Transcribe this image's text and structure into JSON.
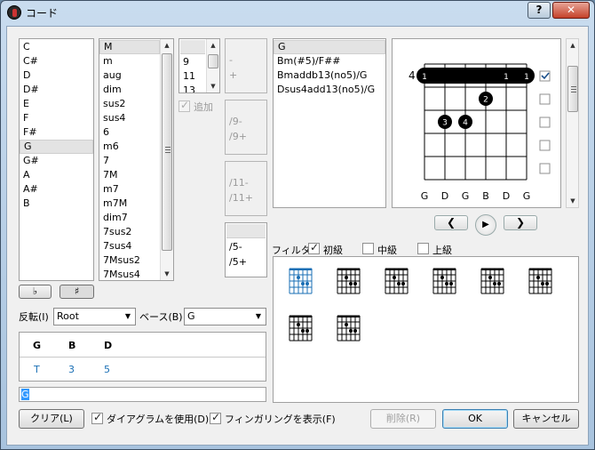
{
  "window": {
    "title": "コード",
    "help": "?",
    "close": "✕"
  },
  "root_list": [
    "C",
    "C#",
    "D",
    "D#",
    "E",
    "F",
    "F#",
    "G",
    "G#",
    "A",
    "A#",
    "B"
  ],
  "root_selected": 7,
  "quality_list": [
    "M",
    "m",
    "aug",
    "dim",
    "sus2",
    "sus4",
    "6",
    "m6",
    "7",
    "7M",
    "m7",
    "m7M",
    "dim7",
    "7sus2",
    "7sus4",
    "7Msus2",
    "7Msus4"
  ],
  "quality_selected": 0,
  "ext_list": [
    "",
    "9",
    "11",
    "13"
  ],
  "add_label": "追加",
  "alter1": [
    "-",
    "+"
  ],
  "alter2": [
    "/9-",
    "/9+"
  ],
  "alter3": [
    "/11-",
    "/11+"
  ],
  "alter4": [
    "",
    "/5-",
    "/5+"
  ],
  "names": [
    "G",
    "Bm(#5)/F##",
    "Bmaddb13(no5)/G",
    "Dsus4add13(no5)/G"
  ],
  "flat_btn": "♭",
  "sharp_btn": "♯",
  "inversion_label": "反転(I)",
  "inversion_value": "Root",
  "bass_label": "ベース(B)",
  "bass_value": "G",
  "notes": {
    "headers": [
      "G",
      "B",
      "D"
    ],
    "degrees": [
      "T",
      "3",
      "5"
    ]
  },
  "chord_input": "G",
  "fret_label": "4",
  "string_names": [
    "G",
    "D",
    "G",
    "B",
    "D",
    "G"
  ],
  "barre_labels": [
    "1",
    "1",
    "1"
  ],
  "finger_labels": [
    "2",
    "3",
    "4"
  ],
  "filter": {
    "label": "フィルタ:",
    "beginner": "初級",
    "intermediate": "中級",
    "advanced": "上級"
  },
  "buttons": {
    "clear": "クリア(L)",
    "use_diagram": "ダイアグラムを使用(D)",
    "show_fingering": "フィンガリングを表示(F)",
    "delete": "削除(R)",
    "ok": "OK",
    "cancel": "キャンセル"
  },
  "colors": {
    "accent": "#1a6fb5",
    "barre": "#000000"
  }
}
